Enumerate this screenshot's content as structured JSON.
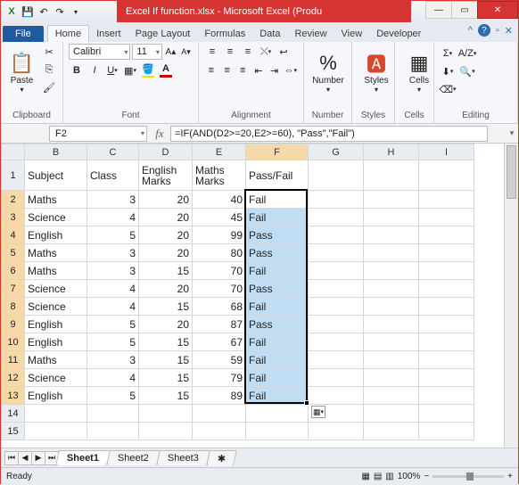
{
  "title": "Excel If function.xlsx - Microsoft Excel (Produ",
  "tabs": {
    "file": "File",
    "home": "Home",
    "insert": "Insert",
    "pagelayout": "Page Layout",
    "formulas": "Formulas",
    "data": "Data",
    "review": "Review",
    "view": "View",
    "developer": "Developer"
  },
  "ribbon": {
    "clipboard": {
      "paste": "Paste",
      "label": "Clipboard"
    },
    "font": {
      "name": "Calibri",
      "size": "11",
      "label": "Font"
    },
    "alignment": {
      "label": "Alignment"
    },
    "number": {
      "label": "Number",
      "btn": "Number"
    },
    "styles": {
      "label": "Styles",
      "btn": "Styles"
    },
    "cells": {
      "label": "Cells",
      "btn": "Cells"
    },
    "editing": {
      "label": "Editing"
    }
  },
  "namebox": "F2",
  "formula": "=IF(AND(D2>=20,E2>=60), \"Pass\",\"Fail\")",
  "cols": [
    "B",
    "C",
    "D",
    "E",
    "F",
    "G",
    "H",
    "I"
  ],
  "headerRow": {
    "b": "Subject",
    "c": "Class",
    "d": "English Marks",
    "e": "Maths Marks",
    "f": "Pass/Fail"
  },
  "rows": [
    {
      "n": 2,
      "b": "Maths",
      "c": 3,
      "d": 20,
      "e": 40,
      "f": "Fail"
    },
    {
      "n": 3,
      "b": "Science",
      "c": 4,
      "d": 20,
      "e": 45,
      "f": "Fail"
    },
    {
      "n": 4,
      "b": "English",
      "c": 5,
      "d": 20,
      "e": 99,
      "f": "Pass"
    },
    {
      "n": 5,
      "b": "Maths",
      "c": 3,
      "d": 20,
      "e": 80,
      "f": "Pass"
    },
    {
      "n": 6,
      "b": "Maths",
      "c": 3,
      "d": 15,
      "e": 70,
      "f": "Fail"
    },
    {
      "n": 7,
      "b": "Science",
      "c": 4,
      "d": 20,
      "e": 70,
      "f": "Pass"
    },
    {
      "n": 8,
      "b": "Science",
      "c": 4,
      "d": 15,
      "e": 68,
      "f": "Fail"
    },
    {
      "n": 9,
      "b": "English",
      "c": 5,
      "d": 20,
      "e": 87,
      "f": "Pass"
    },
    {
      "n": 10,
      "b": "English",
      "c": 5,
      "d": 15,
      "e": 67,
      "f": "Fail"
    },
    {
      "n": 11,
      "b": "Maths",
      "c": 3,
      "d": 15,
      "e": 59,
      "f": "Fail"
    },
    {
      "n": 12,
      "b": "Science",
      "c": 4,
      "d": 15,
      "e": 79,
      "f": "Fail"
    },
    {
      "n": 13,
      "b": "English",
      "c": 5,
      "d": 15,
      "e": 89,
      "f": "Fail"
    }
  ],
  "sheets": {
    "s1": "Sheet1",
    "s2": "Sheet2",
    "s3": "Sheet3"
  },
  "status": {
    "ready": "Ready",
    "zoom": "100%"
  }
}
